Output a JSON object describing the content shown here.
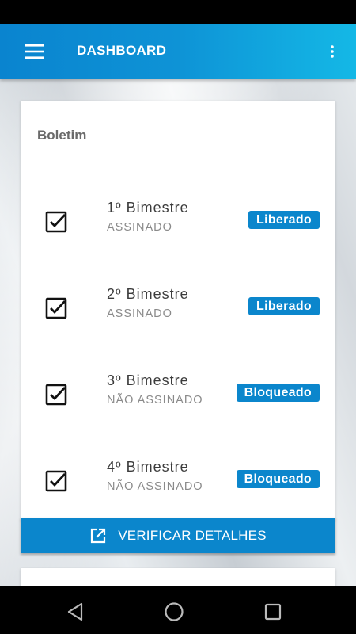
{
  "app_bar": {
    "title": "DASHBOARD",
    "menu_icon": "hamburger-menu-icon",
    "overflow_icon": "more-vertical-icon"
  },
  "card": {
    "title": "Boletim",
    "rows": [
      {
        "name": "1º Bimestre",
        "status": "ASSINADO",
        "badge": "Liberado"
      },
      {
        "name": "2º Bimestre",
        "status": "ASSINADO",
        "badge": "Liberado"
      },
      {
        "name": "3º Bimestre",
        "status": "NÃO ASSINADO",
        "badge": "Bloqueado"
      },
      {
        "name": "4º Bimestre",
        "status": "NÃO ASSINADO",
        "badge": "Bloqueado"
      }
    ]
  },
  "verify_button": {
    "label": "VERIFICAR DETALHES",
    "icon": "open-external-icon"
  },
  "nav": {
    "back_icon": "back-triangle-icon",
    "home_icon": "home-circle-icon",
    "recents_icon": "recents-square-icon"
  },
  "colors": {
    "accent": "#0b86cc",
    "app_bar_start": "#0a84cf",
    "app_bar_end": "#14b8e6"
  }
}
